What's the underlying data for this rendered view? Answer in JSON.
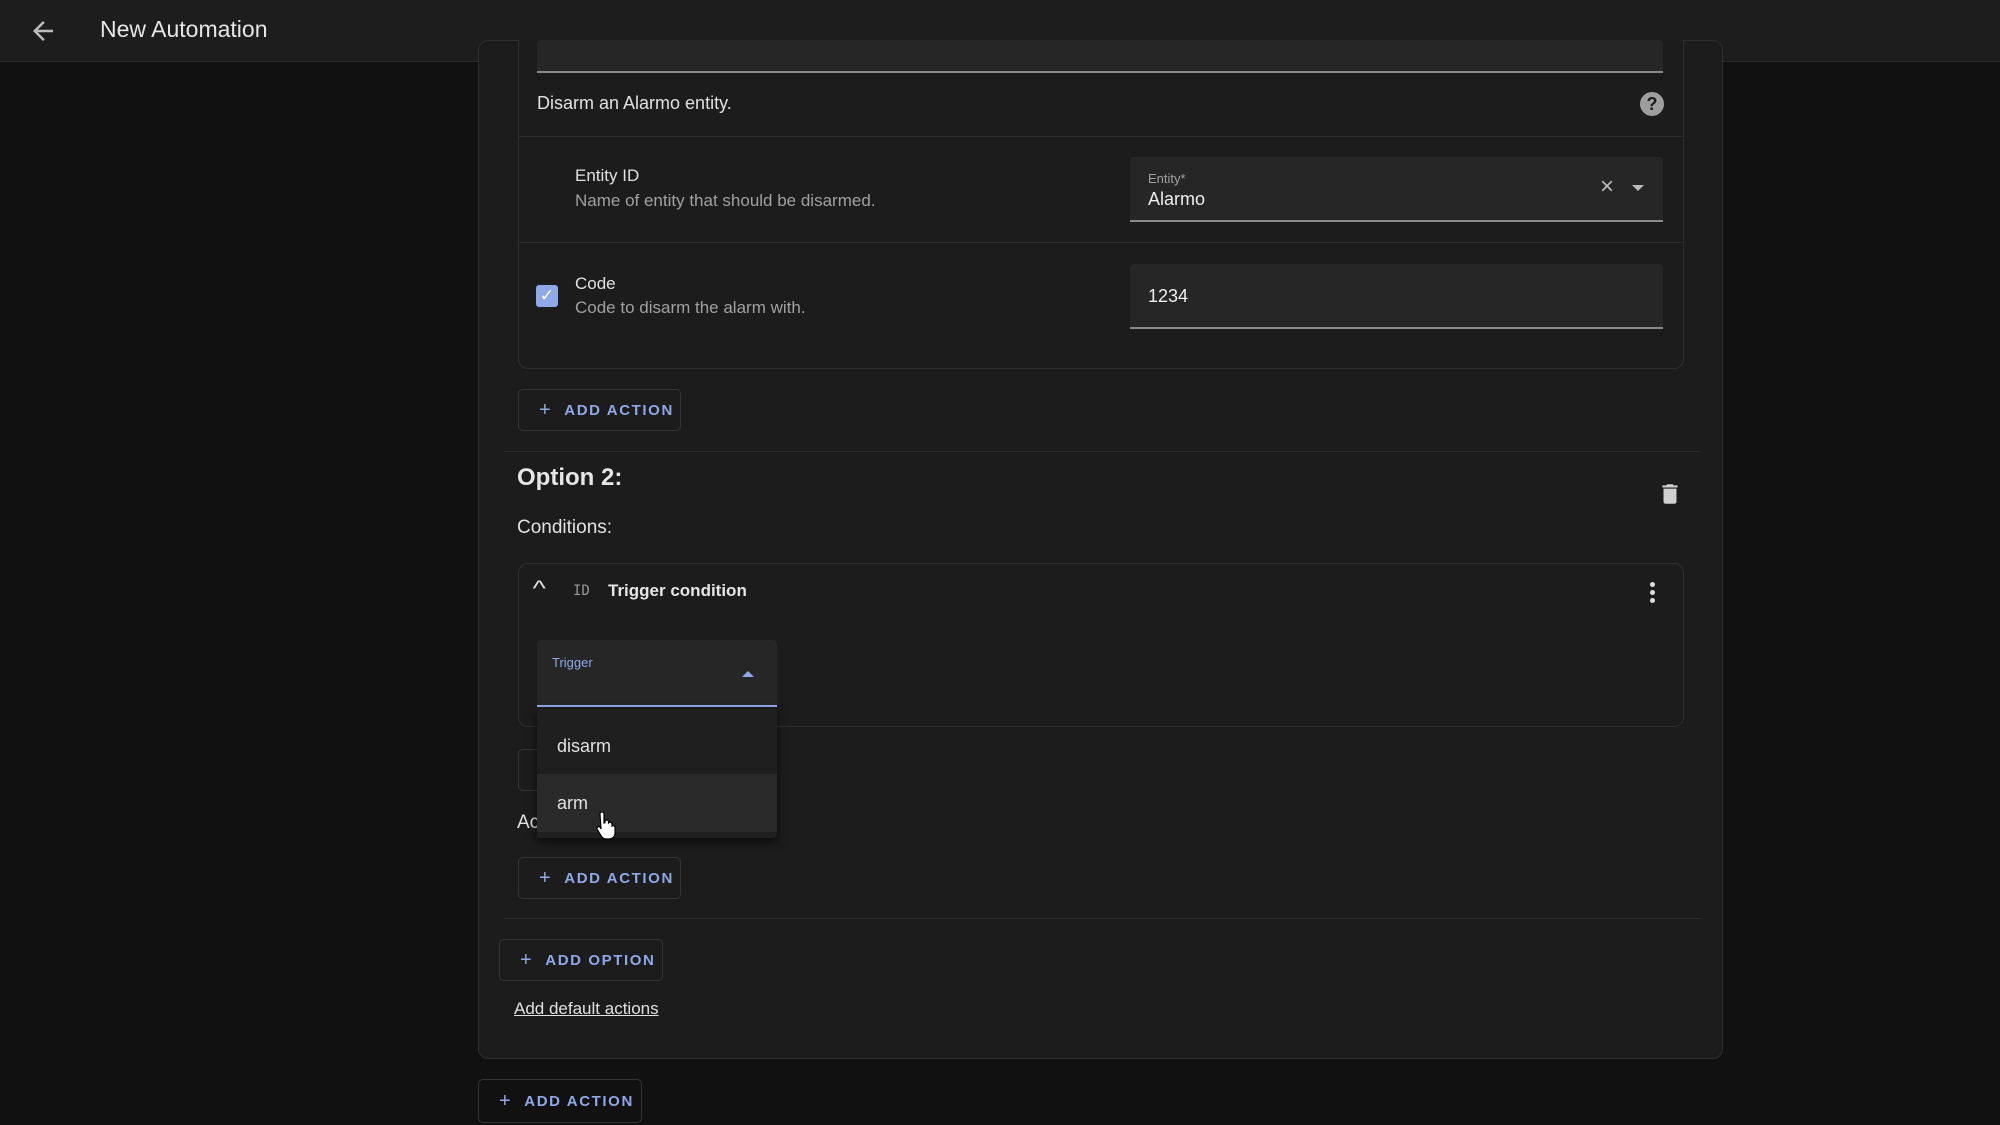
{
  "header": {
    "title": "New Automation",
    "back_icon": "arrow-left-icon"
  },
  "option1": {
    "action_description": "Disarm an Alarmo entity.",
    "entity": {
      "label": "Entity ID",
      "description": "Name of entity that should be disarmed.",
      "field_label": "Entity*",
      "value": "Alarmo"
    },
    "code": {
      "label": "Code",
      "description": "Code to disarm the alarm with.",
      "value": "1234",
      "checked": true
    },
    "add_action_label": "ADD ACTION"
  },
  "option2": {
    "title": "Option 2:",
    "conditions_label": "Conditions:",
    "condition": {
      "id_badge": "ID",
      "title": "Trigger condition",
      "select_label": "Trigger"
    },
    "dropdown_options": [
      "disarm",
      "arm"
    ],
    "hovered_option": "arm",
    "actions_label": "Actions:",
    "add_action_label": "ADD ACTION"
  },
  "add_option_label": "ADD OPTION",
  "add_default_actions_label": "Add default actions",
  "bottom_add_action_label": "ADD ACTION",
  "colors": {
    "accent": "#8fa8e8",
    "background": "#111111",
    "card": "#1c1c1c"
  }
}
